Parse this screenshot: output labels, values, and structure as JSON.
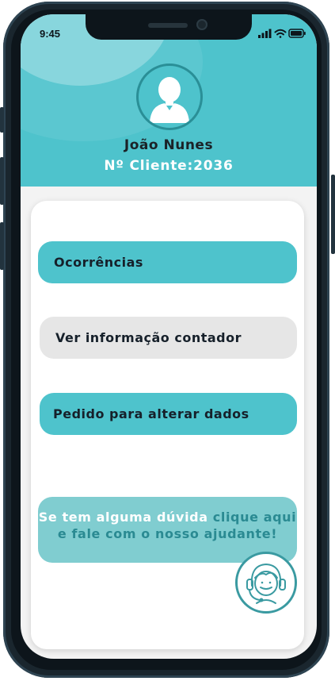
{
  "status_bar": {
    "time": "9:45"
  },
  "profile": {
    "name": "João Nunes",
    "client_number": "Nº Cliente:2036"
  },
  "menu": {
    "occurrences": "Ocorrências",
    "meter_info": "Ver informação contador",
    "change_data": "Pedido para alterar dados"
  },
  "help": {
    "text_part1": "Se tem alguma dúvida",
    "text_part2": "clique aqui e fale com o nosso ajudante!"
  },
  "colors": {
    "accent": "#4ec3cc",
    "accent_dark": "#2a8f97",
    "help_bg": "#80cdd0",
    "secondary_button": "#e6e6e6"
  },
  "icons": {
    "avatar": "user-avatar-icon",
    "support": "support-agent-icon",
    "signal": "signal-icon",
    "wifi": "wifi-icon",
    "battery": "battery-icon"
  }
}
